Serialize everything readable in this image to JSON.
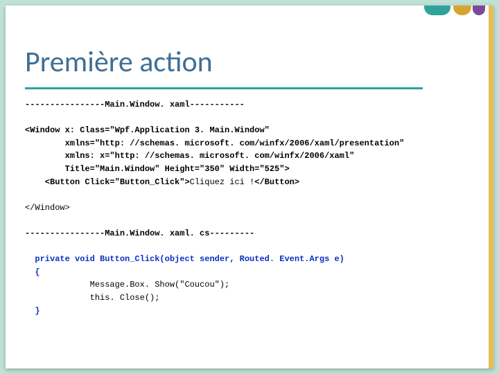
{
  "title": "Première action",
  "sep1": "----------------Main.Window. xaml-----------",
  "code1_l1": "<Window x: Class=\"Wpf.Application 3. Main.Window\"",
  "code1_l2": "        xmlns=\"http: //schemas. microsoft. com/winfx/2006/xaml/presentation\"",
  "code1_l3": "        xmlns: x=\"http: //schemas. microsoft. com/winfx/2006/xaml\"",
  "code1_l4": "        Title=\"Main.Window\" Height=\"350\" Width=\"525\">",
  "code1_l5a": "    <Button Click=\"Button_Click\">",
  "code1_l5b": "Cliquez ici !",
  "code1_l5c": "</Button>",
  "code1_l6": "</Window>",
  "sep2": "----------------Main.Window. xaml. cs---------",
  "code2_l1a": "  private void Button_Click(object sender, ",
  "code2_l1b": "Routed. Event.Args e)",
  "code2_l2": "  {",
  "code2_l3": "             Message.Box. Show(\"Coucou\");",
  "code2_l4": "             this. Close();",
  "code2_l5": "  }"
}
